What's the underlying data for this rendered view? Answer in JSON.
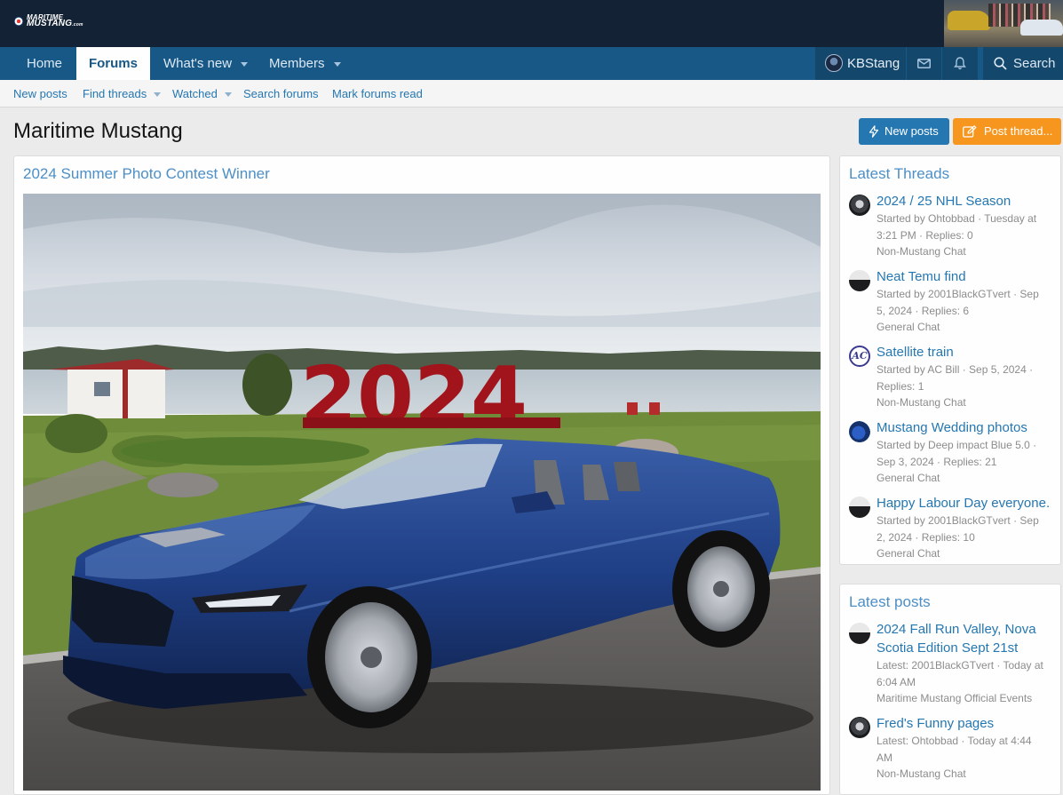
{
  "header": {
    "logo_top": "MARITIME",
    "logo_main": "MUSTANG",
    "logo_suffix": ".com"
  },
  "nav": {
    "tabs": [
      {
        "label": "Home"
      },
      {
        "label": "Forums",
        "active": true
      },
      {
        "label": "What's new"
      },
      {
        "label": "Members"
      }
    ],
    "username": "KBStang",
    "search_label": "Search",
    "icons": [
      "envelope-icon",
      "bell-icon",
      "search-icon"
    ]
  },
  "subnav": {
    "items": [
      "New posts",
      "Find threads",
      "Watched",
      "Search forums",
      "Mark forums read"
    ]
  },
  "page": {
    "title": "Maritime Mustang",
    "new_posts_button": "New posts",
    "post_thread_button": "Post thread..."
  },
  "main": {
    "title": "2024 Summer Photo Contest Winner",
    "photo_sign_text": "2024"
  },
  "latest_threads": {
    "title": "Latest Threads",
    "items": [
      {
        "title": "2024 / 25 NHL Season",
        "meta_line1": "Started by Ohtobbad · Tuesday at",
        "meta_line2": "3:21 PM · Replies: 0",
        "forum": "Non-Mustang Chat"
      },
      {
        "title": "Neat Temu find",
        "meta_line1": "Started by 2001BlackGTvert · Sep",
        "meta_line2": "5, 2024 · Replies: 6",
        "forum": "General Chat"
      },
      {
        "title": "Satellite train",
        "meta_line1": "Started by AC Bill · Sep 5, 2024 ·",
        "meta_line2": "Replies: 1",
        "forum": "Non-Mustang Chat"
      },
      {
        "title": "Mustang Wedding photos",
        "meta_line1": "Started by Deep impact Blue 5.0 ·",
        "meta_line2": "Sep 3, 2024 · Replies: 21",
        "forum": "General Chat"
      },
      {
        "title": "Happy Labour Day everyone.",
        "meta_line1": "Started by 2001BlackGTvert · Sep",
        "meta_line2": "2, 2024 · Replies: 10",
        "forum": "General Chat"
      }
    ]
  },
  "latest_posts": {
    "title": "Latest posts",
    "items": [
      {
        "title_line1": "2024 Fall Run Valley, Nova",
        "title_line2": "Scotia Edition Sept 21st",
        "meta_line1": "Latest: 2001BlackGTvert · Today at",
        "meta_line2": "6:04 AM",
        "forum": "Maritime Mustang Official Events"
      },
      {
        "title_line1": "Fred's Funny pages",
        "title_line2": "",
        "meta_line1": "Latest: Ohtobbad · Today at 4:44",
        "meta_line2": "AM",
        "forum": "Non-Mustang Chat"
      }
    ]
  },
  "avatars": {
    "ac_bill_initials": "AC"
  },
  "colors": {
    "header_bg": "#132235",
    "nav_bg": "#185886",
    "link": "#2577b1",
    "block_title": "#4d8fc6",
    "button_blue": "#2577b1",
    "button_orange": "#f7961e"
  }
}
